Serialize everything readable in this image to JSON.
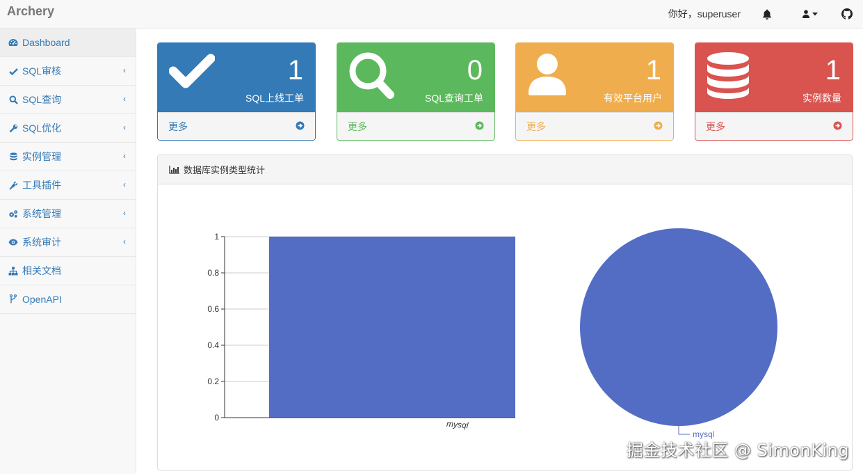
{
  "brand": "Archery",
  "header": {
    "greeting": "你好，superuser"
  },
  "sidebar": {
    "items": [
      {
        "label": "Dashboard",
        "icon": "dashboard-icon",
        "active": true
      },
      {
        "label": "SQL审核",
        "icon": "check-icon",
        "submenu": true
      },
      {
        "label": "SQL查询",
        "icon": "search-icon",
        "submenu": true
      },
      {
        "label": "SQL优化",
        "icon": "wrench-icon",
        "submenu": true
      },
      {
        "label": "实例管理",
        "icon": "database-icon",
        "submenu": true
      },
      {
        "label": "工具插件",
        "icon": "plug-icon",
        "submenu": true
      },
      {
        "label": "系统管理",
        "icon": "cogs-icon",
        "submenu": true
      },
      {
        "label": "系统审计",
        "icon": "eye-icon",
        "submenu": true
      },
      {
        "label": "相关文档",
        "icon": "sitemap-icon"
      },
      {
        "label": "OpenAPI",
        "icon": "code-fork-icon"
      }
    ]
  },
  "stats": [
    {
      "value": "1",
      "label": "SQL上线工单",
      "more": "更多",
      "color": "#337ab7",
      "icon": "check-icon"
    },
    {
      "value": "0",
      "label": "SQL查询工单",
      "more": "更多",
      "color": "#5cb85c",
      "icon": "search-icon"
    },
    {
      "value": "1",
      "label": "有效平台用户",
      "more": "更多",
      "color": "#f0ad4e",
      "icon": "user-icon"
    },
    {
      "value": "1",
      "label": "实例数量",
      "more": "更多",
      "color": "#d9534f",
      "icon": "database-icon"
    }
  ],
  "chart_panel": {
    "title": "数据库实例类型统计"
  },
  "chart_data": [
    {
      "type": "bar",
      "categories": [
        "mysql"
      ],
      "values": [
        1
      ],
      "ylim": [
        0,
        1
      ],
      "yticks": [
        "0",
        "0.2",
        "0.4",
        "0.6",
        "0.8",
        "1"
      ],
      "color": "#536dc4",
      "grid": true
    },
    {
      "type": "pie",
      "labels": [
        "mysql"
      ],
      "values": [
        1
      ],
      "color": "#536dc4"
    }
  ],
  "watermark": "掘金技术社区 @ SimonKing"
}
